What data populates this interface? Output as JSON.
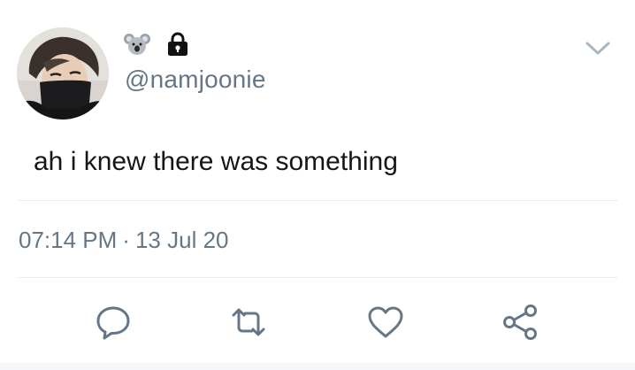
{
  "author": {
    "handle": "@namjoonie",
    "badges": [
      "koala-icon",
      "lock-icon"
    ]
  },
  "tweet": {
    "text": "ah i knew there was something",
    "time": "07:14 PM",
    "separator": "·",
    "date": "13 Jul 20"
  },
  "actions": [
    "reply-icon",
    "retweet-icon",
    "like-icon",
    "share-icon"
  ],
  "colors": {
    "text": "#14171a",
    "secondary": "#657786",
    "icon": "#657786",
    "divider": "#e6ecf0"
  }
}
